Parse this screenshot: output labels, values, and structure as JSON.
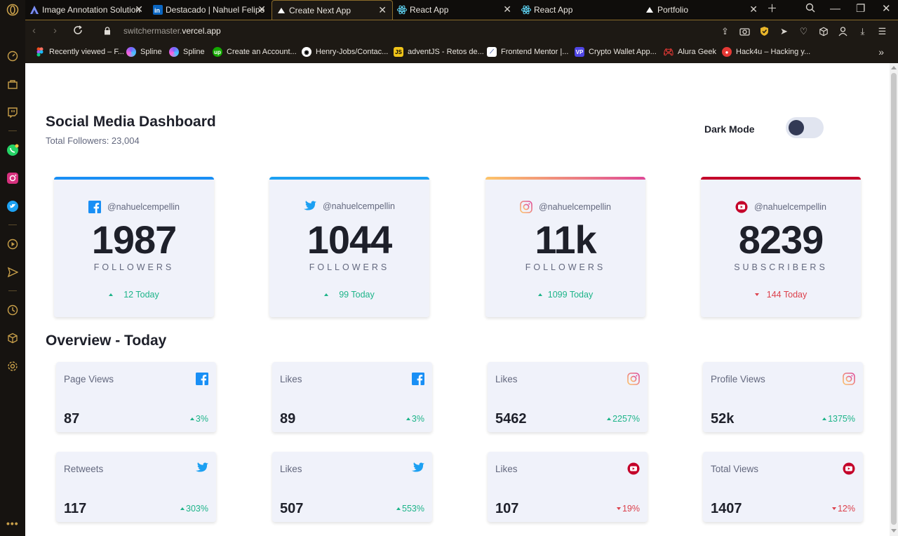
{
  "browser": {
    "tabs": [
      {
        "title": "Image Annotation Solution",
        "favicon": "annotation-logo-icon"
      },
      {
        "title": "Destacado | Nahuel Felipe",
        "favicon": "linkedin-icon"
      },
      {
        "title": "Create Next App",
        "favicon": "vercel-triangle-icon",
        "active": true
      },
      {
        "title": "React App",
        "favicon": "react-icon"
      },
      {
        "title": "React App",
        "favicon": "react-icon"
      },
      {
        "title": "Portfolio",
        "favicon": "vercel-triangle-icon"
      }
    ],
    "url_host": "switchermaster.",
    "url_domain": "vercel.app",
    "bookmarks": [
      {
        "label": "Recently viewed – F...",
        "icon": "figma-icon",
        "color": "#a259ff"
      },
      {
        "label": "Spline",
        "icon": "spline-icon",
        "color": "#7b61ff"
      },
      {
        "label": "Spline",
        "icon": "spline-icon",
        "color": "#7b61ff"
      },
      {
        "label": "Create an Account...",
        "icon": "upwork-icon",
        "color": "#14a800"
      },
      {
        "label": "Henry-Jobs/Contac...",
        "icon": "github-icon",
        "color": "#ffffff"
      },
      {
        "label": "adventJS - Retos de...",
        "icon": "js-icon",
        "color": "#f0c419"
      },
      {
        "label": "Frontend Mentor |...",
        "icon": "frontend-mentor-icon",
        "color": "#ffffff"
      },
      {
        "label": "Crypto Wallet App...",
        "icon": "vp-icon",
        "color": "#4f46e5"
      },
      {
        "label": "Alura Geek",
        "icon": "gamepad-icon",
        "color": "#e53935"
      },
      {
        "label": "Hack4u – Hacking y...",
        "icon": "hack4u-icon",
        "color": "#e53935"
      }
    ]
  },
  "dashboard": {
    "title": "Social Media Dashboard",
    "subtitle": "Total Followers: 23,004",
    "dark_mode_label": "Dark Mode",
    "dark_mode_on": false
  },
  "follower_cards": [
    {
      "platform": "facebook",
      "handle": "@nahuelcempellin",
      "count": "1987",
      "label": "FOLLOWERS",
      "today": "12 Today",
      "trend": "up",
      "bar_color": "#198ff5"
    },
    {
      "platform": "twitter",
      "handle": "@nahuelcempellin",
      "count": "1044",
      "label": "FOLLOWERS",
      "today": "99 Today",
      "trend": "up",
      "bar_color": "#1ca0f2"
    },
    {
      "platform": "instagram",
      "handle": "@nahuelcempellin",
      "count": "11k",
      "label": "FOLLOWERS",
      "today": "1099 Today",
      "trend": "up",
      "bar_color": "linear-gradient(90deg,#fdc468,#df4996)"
    },
    {
      "platform": "youtube",
      "handle": "@nahuelcempellin",
      "count": "8239",
      "label": "SUBSCRIBERS",
      "today": "144 Today",
      "trend": "down",
      "bar_color": "#c4032a"
    }
  ],
  "overview": {
    "title": "Overview - Today",
    "cards": [
      {
        "name": "Page Views",
        "platform": "facebook",
        "value": "87",
        "pct": "3%",
        "trend": "up"
      },
      {
        "name": "Likes",
        "platform": "facebook",
        "value": "89",
        "pct": "3%",
        "trend": "up"
      },
      {
        "name": "Likes",
        "platform": "instagram",
        "value": "5462",
        "pct": "2257%",
        "trend": "up"
      },
      {
        "name": "Profile Views",
        "platform": "instagram",
        "value": "52k",
        "pct": "1375%",
        "trend": "up"
      },
      {
        "name": "Retweets",
        "platform": "twitter",
        "value": "117",
        "pct": "303%",
        "trend": "up"
      },
      {
        "name": "Likes",
        "platform": "twitter",
        "value": "507",
        "pct": "553%",
        "trend": "up"
      },
      {
        "name": "Likes",
        "platform": "youtube",
        "value": "107",
        "pct": "19%",
        "trend": "down"
      },
      {
        "name": "Total Views",
        "platform": "youtube",
        "value": "1407",
        "pct": "12%",
        "trend": "down"
      }
    ]
  },
  "colors": {
    "up": "#1db489",
    "down": "#dc414c",
    "facebook": "#198ff5",
    "twitter": "#1ca0f2",
    "youtube": "#c4032a",
    "accent": "#c9a04a"
  }
}
